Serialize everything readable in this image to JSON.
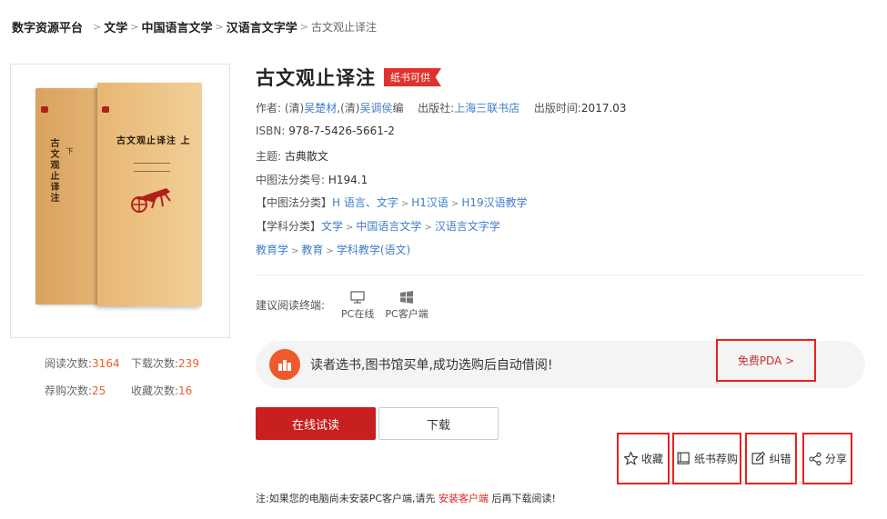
{
  "breadcrumb": {
    "root": "数字资源平台",
    "items": [
      "文学",
      "中国语言文学",
      "汉语言文字学"
    ],
    "current": "古文观止译注"
  },
  "cover": {
    "spine_title": "古文观止译注",
    "spine_note": "下",
    "front_title": "古文观止译注 上"
  },
  "stats": {
    "read_label": "阅读次数:",
    "read_value": "3164",
    "download_label": "下载次数:",
    "download_value": "239",
    "recommend_label": "荐购次数:",
    "recommend_value": "25",
    "favorite_label": "收藏次数:",
    "favorite_value": "16"
  },
  "book": {
    "title": "古文观止译注",
    "badge": "纸书可供",
    "author_label": "作者:",
    "author_prefix1": "(清)",
    "author1": "吴楚材",
    "author_sep": ",",
    "author_prefix2": "(清)",
    "author2": "吴调侯",
    "author_role": "编",
    "publisher_label": "出版社:",
    "publisher": "上海三联书店",
    "pubdate_label": "出版时间:",
    "pubdate": "2017.03",
    "isbn_label": "ISBN:",
    "isbn": "978-7-5426-5661-2",
    "subject_label": "主题:",
    "subject": "古典散文",
    "clc_label": "中图法分类号:",
    "clc": "H194.1",
    "clc_cat_label": "【中图法分类】",
    "clc_cats": [
      "H 语言、文字",
      "H1汉语",
      "H19汉语教学"
    ],
    "disc_cat_label": "【学科分类】",
    "disc_cats": [
      "文学",
      "中国语言文学",
      "汉语言文字学"
    ],
    "disc_cats2": [
      "教育学",
      "教育",
      "学科教学(语文)"
    ]
  },
  "terminal": {
    "label": "建议阅读终端:",
    "items": [
      {
        "label": "PC在线",
        "icon": "monitor-icon"
      },
      {
        "label": "PC客户端",
        "icon": "windows-icon"
      }
    ]
  },
  "pda": {
    "text": "读者选书,图书馆买单,成功选购后自动借阅!",
    "link": "免费PDA >"
  },
  "buttons": {
    "read": "在线试读",
    "download": "下载"
  },
  "actions": {
    "favorite": "收藏",
    "recommend": "纸书荐购",
    "correct": "纠错",
    "share": "分享"
  },
  "note": {
    "prefix": "注:如果您的电脑尚未安装PC客户端,请先",
    "link": "安装客户端",
    "suffix": "后再下载阅读!"
  },
  "colors": {
    "accent_red": "#c81f1f",
    "link_blue": "#3f7fc9",
    "stat_orange": "#e8602c",
    "highlight_border": "#e8221c"
  }
}
